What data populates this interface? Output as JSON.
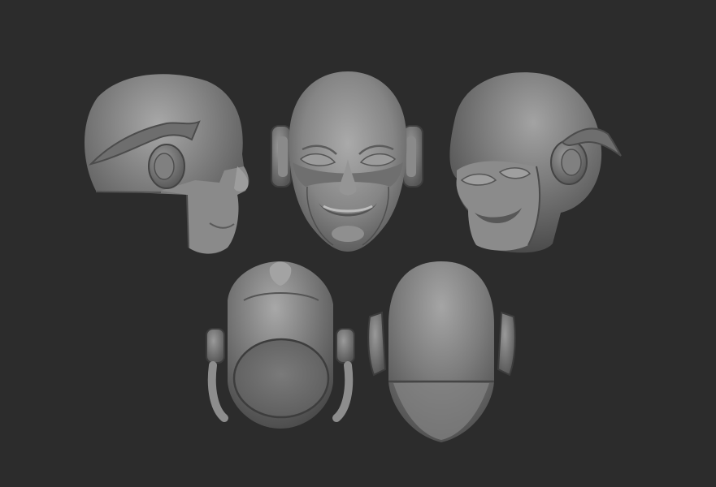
{
  "scene": {
    "background_color": "#2c2c2c",
    "material_color": "#7d7d7d",
    "views": [
      {
        "name": "left-profile-view"
      },
      {
        "name": "front-view"
      },
      {
        "name": "right-three-quarter-view"
      },
      {
        "name": "bottom-view"
      },
      {
        "name": "back-view"
      }
    ]
  }
}
